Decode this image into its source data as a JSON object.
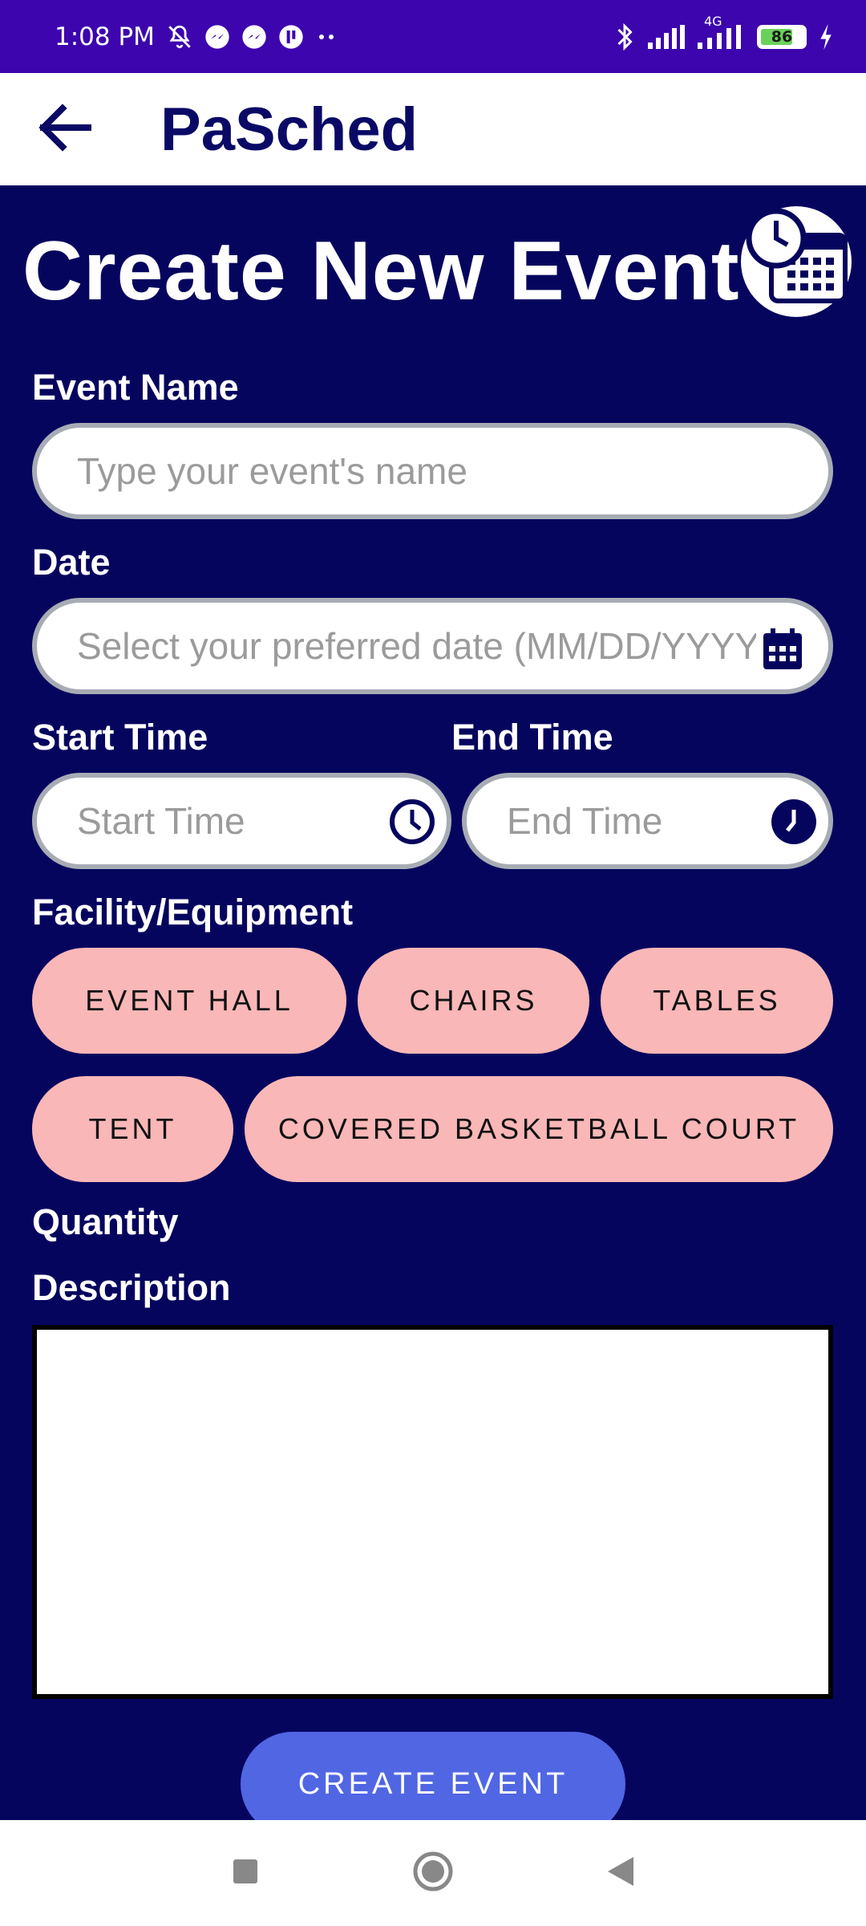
{
  "status_bar": {
    "time": "1:08 PM",
    "battery": "86",
    "network": "4G"
  },
  "app_bar": {
    "title": "PaSched",
    "back_icon": "arrow-left-icon"
  },
  "form": {
    "title": "Create New Event",
    "event_name": {
      "label": "Event Name",
      "placeholder": "Type your event's name",
      "value": ""
    },
    "date": {
      "label": "Date",
      "placeholder": "Select your preferred date (MM/DD/YYYY)",
      "value": ""
    },
    "start_time": {
      "label": "Start Time",
      "placeholder": "Start Time",
      "value": ""
    },
    "end_time": {
      "label": "End Time",
      "placeholder": "End Time",
      "value": ""
    },
    "facility_label": "Facility/Equipment",
    "facilities": [
      "EVENT HALL",
      "CHAIRS",
      "TABLES",
      "TENT",
      "COVERED BASKETBALL COURT"
    ],
    "quantity_label": "Quantity",
    "description_label": "Description",
    "description_value": "",
    "submit_label": "CREATE EVENT"
  },
  "colors": {
    "status_bar": "#3d05ae",
    "background": "#06055e",
    "chip": "#fab7b7",
    "button": "#5066e3",
    "title_dark": "#0a0a66"
  }
}
